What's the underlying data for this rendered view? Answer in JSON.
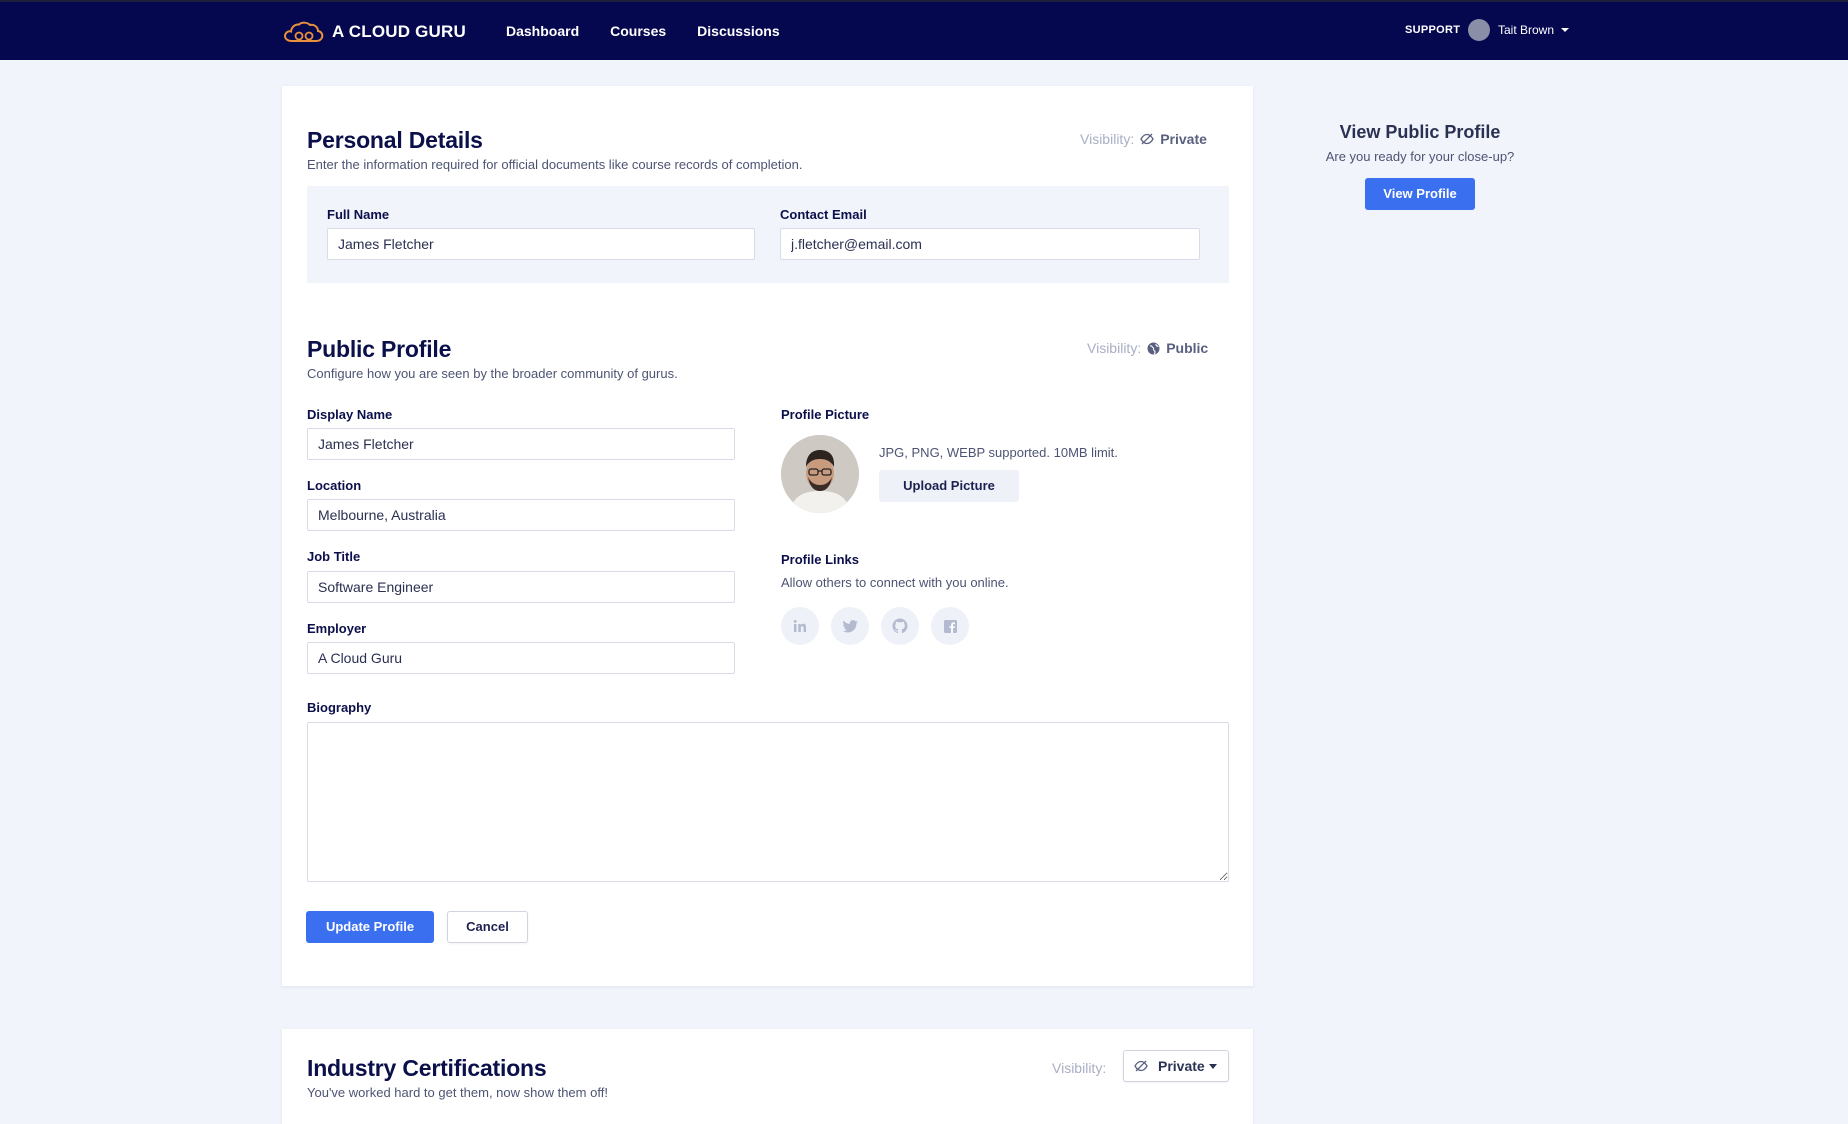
{
  "brand": {
    "name": "A CLOUD GURU",
    "accent": "#e8903c"
  },
  "nav": {
    "items": [
      "Dashboard",
      "Courses",
      "Discussions"
    ]
  },
  "header": {
    "support": "SUPPORT",
    "user_name": "Tait Brown"
  },
  "personal": {
    "title": "Personal Details",
    "subtitle": "Enter the information required for official documents like course records of completion.",
    "visibility_label": "Visibility:",
    "visibility_value": "Private",
    "visibility_icon": "eye-slash-icon",
    "full_name_label": "Full Name",
    "full_name_value": "James Fletcher",
    "email_label": "Contact Email",
    "email_value": "j.fletcher@email.com"
  },
  "public": {
    "title": "Public Profile",
    "subtitle": "Configure how you are seen by the broader community of gurus.",
    "visibility_label": "Visibility:",
    "visibility_value": "Public",
    "visibility_icon": "globe-icon",
    "display_name_label": "Display Name",
    "display_name_value": "James Fletcher",
    "location_label": "Location",
    "location_value": "Melbourne, Australia",
    "job_title_label": "Job Title",
    "job_title_value": "Software Engineer",
    "employer_label": "Employer",
    "employer_value": "A Cloud Guru",
    "picture_label": "Profile Picture",
    "picture_hint": "JPG, PNG, WEBP supported. 10MB limit.",
    "upload_label": "Upload Picture",
    "links_label": "Profile Links",
    "links_hint": "Allow others to connect with you online.",
    "social_icons": [
      "linkedin-icon",
      "twitter-icon",
      "github-icon",
      "facebook-icon"
    ],
    "biography_label": "Biography",
    "biography_value": "",
    "update_label": "Update Profile",
    "cancel_label": "Cancel"
  },
  "side": {
    "title": "View Public Profile",
    "subtitle": "Are you ready for your close-up?",
    "button": "View Profile"
  },
  "certs": {
    "title": "Industry Certifications",
    "subtitle": "You've worked hard to get them, now show them off!",
    "visibility_label": "Visibility:",
    "visibility_value": "Private"
  },
  "colors": {
    "nav_bg": "#06084f",
    "primary": "#3a6ff0",
    "page_bg": "#f1f4fa"
  }
}
